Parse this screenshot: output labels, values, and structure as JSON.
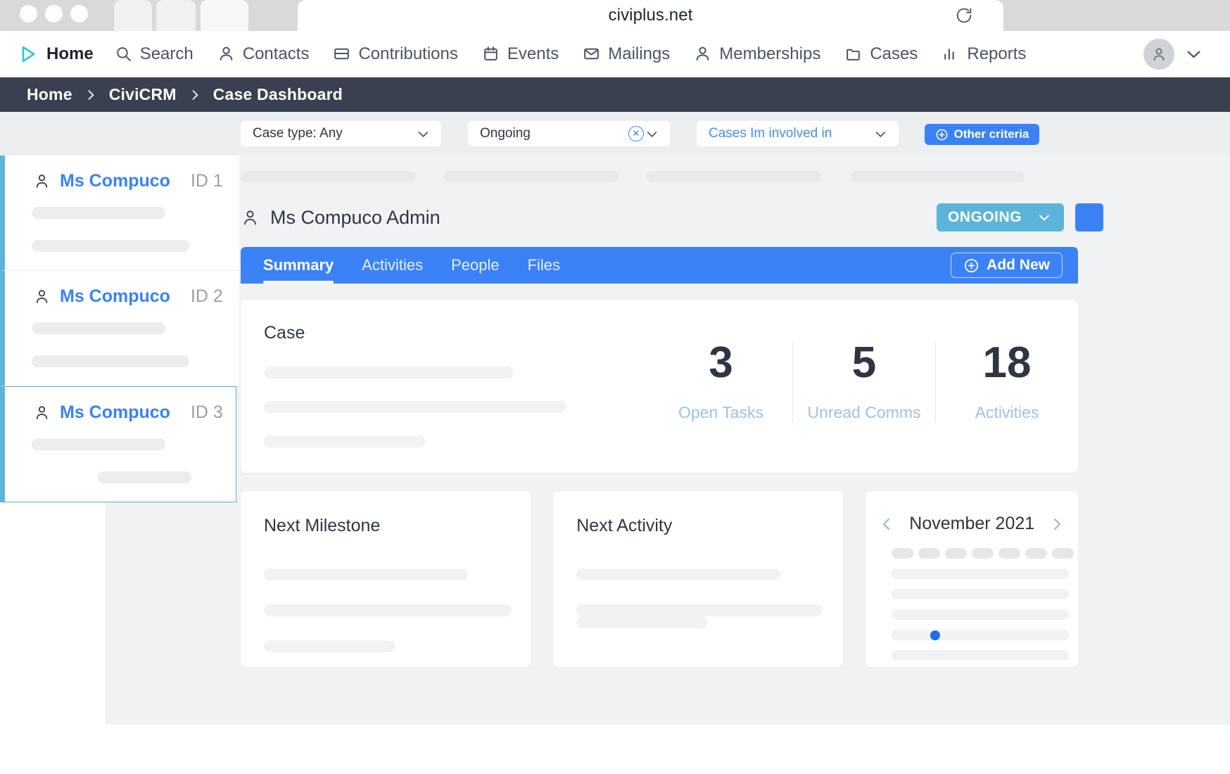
{
  "browser": {
    "url": "civiplus.net",
    "reload_icon": "reload-icon"
  },
  "topnav": {
    "items": [
      {
        "label": "Home",
        "icon": "civicrm-logo-icon"
      },
      {
        "label": "Search",
        "icon": "search-icon"
      },
      {
        "label": "Contacts",
        "icon": "person-icon"
      },
      {
        "label": "Contributions",
        "icon": "card-icon"
      },
      {
        "label": "Events",
        "icon": "calendar-icon"
      },
      {
        "label": "Mailings",
        "icon": "envelope-icon"
      },
      {
        "label": "Memberships",
        "icon": "person-icon"
      },
      {
        "label": "Cases",
        "icon": "folder-icon"
      },
      {
        "label": "Reports",
        "icon": "bar-chart-icon"
      }
    ],
    "avatar_icon": "person-avatar-icon",
    "avatar_chevron_icon": "chevron-down-icon"
  },
  "breadcrumb": {
    "items": [
      "Home",
      "CiviCRM",
      "Case Dashboard"
    ],
    "separator": "›"
  },
  "filter_bar": {
    "title": "Ms Compuco Admin",
    "case_type": {
      "label": "Case type: Any",
      "chevron_icon": "chevron-down-icon"
    },
    "status": {
      "label": "Ongoing",
      "clear_icon": "circle-x-icon",
      "chevron_icon": "chevron-down-icon"
    },
    "involvement": {
      "label": "Cases Im involved in",
      "chevron_icon": "chevron-down-icon"
    },
    "other_criteria": {
      "label": "Other criteria",
      "icon": "plus-circle-icon"
    }
  },
  "case_list": [
    {
      "name": "Ms Compuco",
      "id_label": "ID 1",
      "icon": "person-icon",
      "selected": false
    },
    {
      "name": "Ms Compuco",
      "id_label": "ID 2",
      "icon": "person-icon",
      "selected": false
    },
    {
      "name": "Ms Compuco",
      "id_label": "ID 3",
      "icon": "person-icon",
      "selected": true
    }
  ],
  "main": {
    "case_header": {
      "icon": "person-icon",
      "title": "Ms Compuco Admin",
      "status": {
        "label": "ONGOING",
        "chevron_icon": "chevron-down-icon"
      },
      "menu_icon": "hamburger-menu-icon"
    },
    "tabs": [
      {
        "label": "Summary",
        "active": true
      },
      {
        "label": "Activities",
        "active": false
      },
      {
        "label": "People",
        "active": false
      },
      {
        "label": "Files",
        "active": false
      }
    ],
    "add_new": {
      "label": "Add New",
      "icon": "plus-circle-icon"
    },
    "summary_card": {
      "title": "Case",
      "stats": [
        {
          "value": "3",
          "label": "Open Tasks"
        },
        {
          "value": "5",
          "label": "Unread Comms"
        },
        {
          "value": "18",
          "label": "Activities"
        }
      ]
    },
    "bottom_cards": [
      {
        "title": "Next Milestone"
      },
      {
        "title": "Next Activity"
      }
    ],
    "calendar": {
      "month": "November 2021",
      "prev_icon": "chevron-left-icon",
      "next_icon": "chevron-right-icon"
    }
  },
  "colors": {
    "accent_blue": "#3b82f6",
    "status_blue": "#5cb4d8",
    "breadcrumb_bg": "#3a404f",
    "filter_bg": "#eceef0",
    "page_bg": "#f1f2f4"
  }
}
